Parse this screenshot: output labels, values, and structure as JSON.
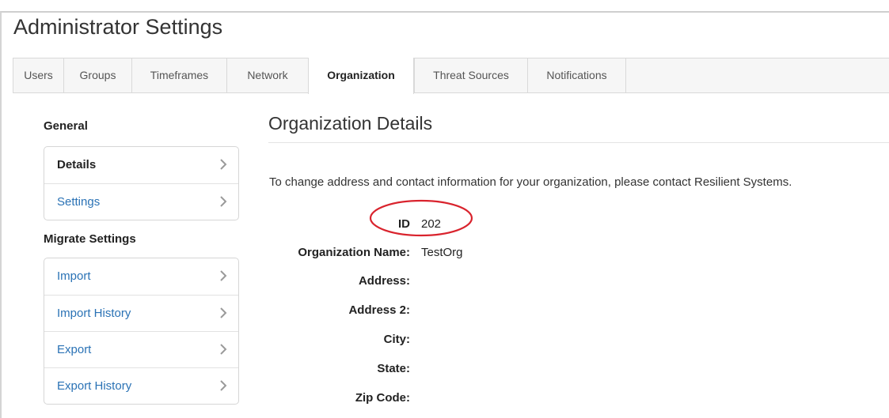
{
  "page": {
    "title": "Administrator Settings"
  },
  "tabs": [
    {
      "label": "Users"
    },
    {
      "label": "Groups"
    },
    {
      "label": "Timeframes"
    },
    {
      "label": "Network"
    },
    {
      "label": "Organization",
      "active": true
    },
    {
      "label": "Threat Sources"
    },
    {
      "label": "Notifications"
    }
  ],
  "sidebar": {
    "general_heading": "General",
    "general_items": [
      {
        "label": "Details",
        "active": true
      },
      {
        "label": "Settings"
      }
    ],
    "migrate_heading": "Migrate Settings",
    "migrate_items": [
      {
        "label": "Import"
      },
      {
        "label": "Import History"
      },
      {
        "label": "Export"
      },
      {
        "label": "Export History"
      }
    ]
  },
  "main": {
    "section_title": "Organization Details",
    "notice": "To change address and contact information for your organization, please contact Resilient Systems.",
    "fields": [
      {
        "label": "ID",
        "value": "202"
      },
      {
        "label": "Organization Name:",
        "value": "TestOrg"
      },
      {
        "label": "Address:",
        "value": ""
      },
      {
        "label": "Address 2:",
        "value": ""
      },
      {
        "label": "City:",
        "value": ""
      },
      {
        "label": "State:",
        "value": ""
      },
      {
        "label": "Zip Code:",
        "value": ""
      }
    ]
  },
  "colors": {
    "link": "#2a72b5",
    "highlight_ellipse": "#d9232d",
    "tab_bar_bg": "#f6f6f6"
  },
  "icons": {
    "nav_chevron": "chevron-right-icon"
  }
}
